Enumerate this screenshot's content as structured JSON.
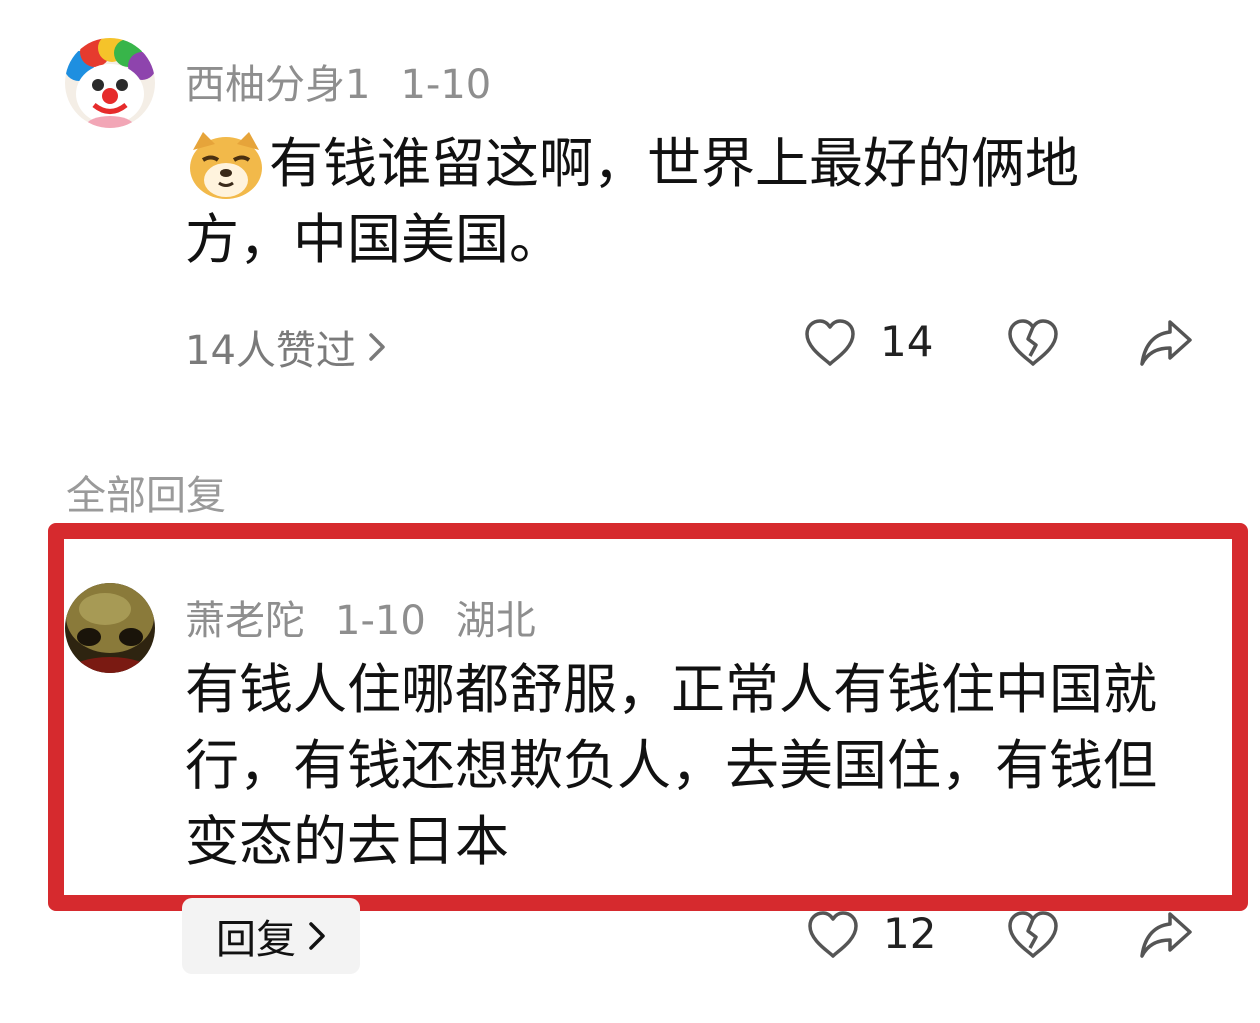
{
  "comment": {
    "username": "西柚分身1",
    "date": "1-10",
    "emoji_icon": "doge-emoji-icon",
    "text": "有钱谁留这啊，世界上最好的俩地方，中国美国。",
    "likes_summary": "14人赞过",
    "like_count": "14"
  },
  "replies_section": {
    "label": "全部回复"
  },
  "reply": {
    "username": "萧老陀",
    "date": "1-10",
    "location": "湖北",
    "text": "有钱人住哪都舒服，正常人有钱住中国就行，有钱还想欺负人，去美国住，有钱但变态的去日本",
    "reply_label": "回复",
    "like_count": "12"
  },
  "colors": {
    "highlight_border": "#d62a2e",
    "meta_gray": "#8e8e8e"
  }
}
